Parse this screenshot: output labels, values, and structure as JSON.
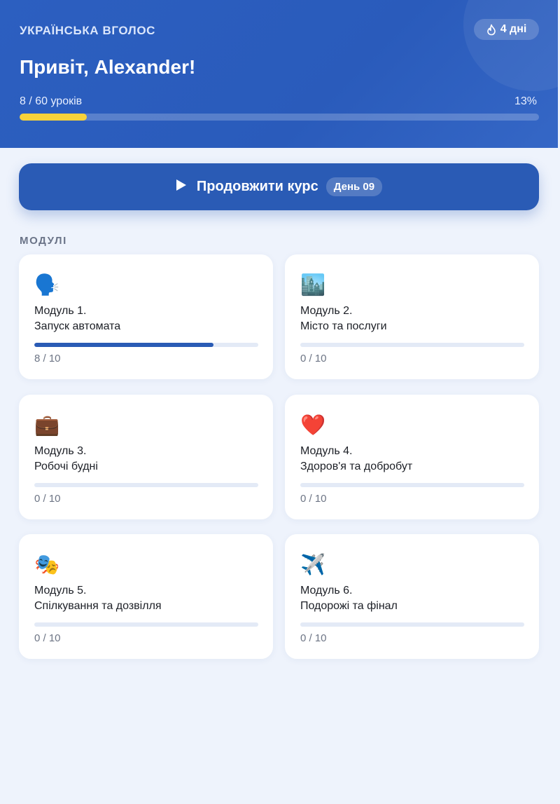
{
  "header": {
    "brand": "УКРАЇНСЬКА ВГОЛОС",
    "streak_label": "4 дні",
    "streak_icon": "flame-icon",
    "greeting": "Привіт, Alexander!",
    "lessons_text": "8 / 60 уроків",
    "percent_text": "13%",
    "progress_fraction": 0.13,
    "progress_color": "#f7d23a"
  },
  "continue": {
    "label": "Продовжити курс",
    "day_badge": "День 09",
    "icon": "play-icon"
  },
  "modules_title": "МОДУЛІ",
  "modules": [
    {
      "icon": "🗣️",
      "icon_name": "speaking-head-icon",
      "number": "Модуль 1.",
      "title": "Запуск автомата",
      "count": "8 / 10",
      "progress": 0.8
    },
    {
      "icon": "🏙️",
      "icon_name": "cityscape-icon",
      "number": "Модуль 2.",
      "title": "Місто та послуги",
      "count": "0 / 10",
      "progress": 0
    },
    {
      "icon": "💼",
      "icon_name": "briefcase-icon",
      "number": "Модуль 3.",
      "title": "Робочі будні",
      "count": "0 / 10",
      "progress": 0
    },
    {
      "icon": "❤️",
      "icon_name": "heart-icon",
      "number": "Модуль 4.",
      "title": "Здоров'я та добробут",
      "count": "0 / 10",
      "progress": 0
    },
    {
      "icon": "🎭",
      "icon_name": "theater-masks-icon",
      "number": "Модуль 5.",
      "title": "Спілкування та дозвілля",
      "count": "0 / 10",
      "progress": 0
    },
    {
      "icon": "✈️",
      "icon_name": "airplane-icon",
      "number": "Модуль 6.",
      "title": "Подорожі та фінал",
      "count": "0 / 10",
      "progress": 0
    }
  ],
  "colors": {
    "accent": "#2a5bb5",
    "background": "#eef3fc",
    "card_track": "#e3eaf6"
  }
}
